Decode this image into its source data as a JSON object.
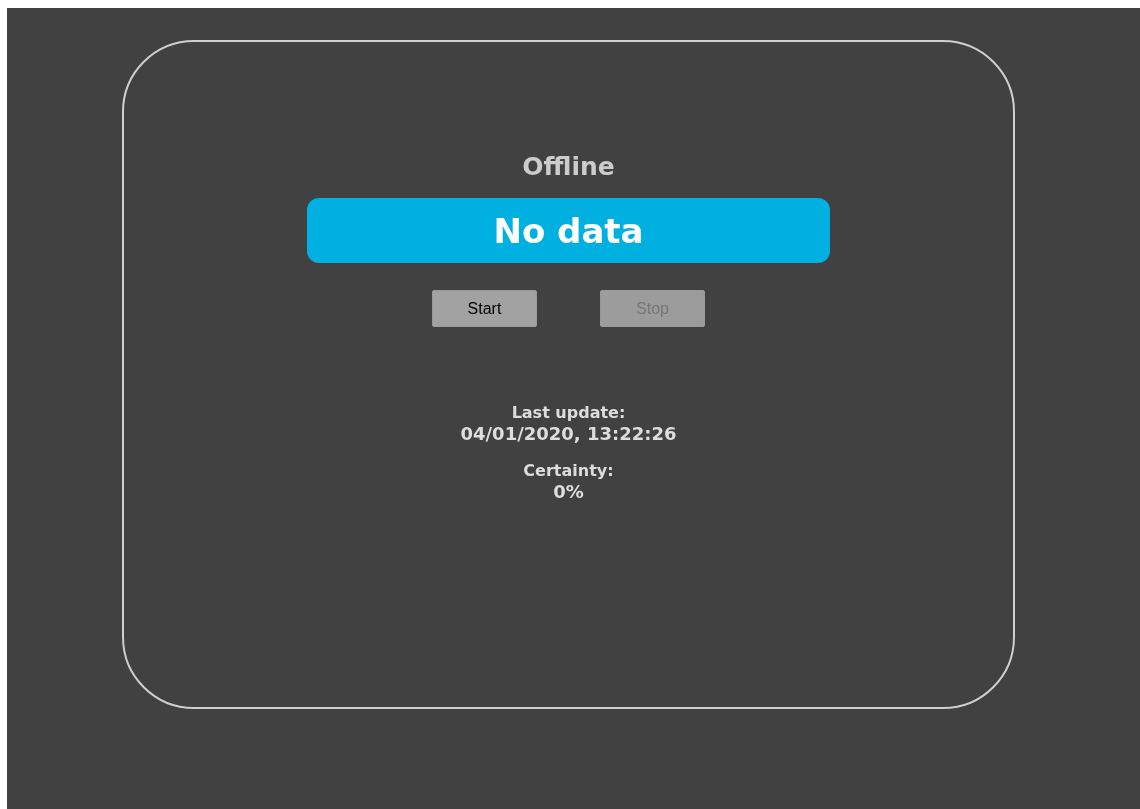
{
  "status": "Offline",
  "display": "No data",
  "buttons": [
    {
      "label": "Start",
      "disabled": false
    },
    {
      "label": "Stop",
      "disabled": true
    }
  ],
  "info": [
    {
      "label": "Last update:",
      "value": "04/01/2020, 13:22:26"
    },
    {
      "label": "Certainty:",
      "value": "0%"
    }
  ]
}
